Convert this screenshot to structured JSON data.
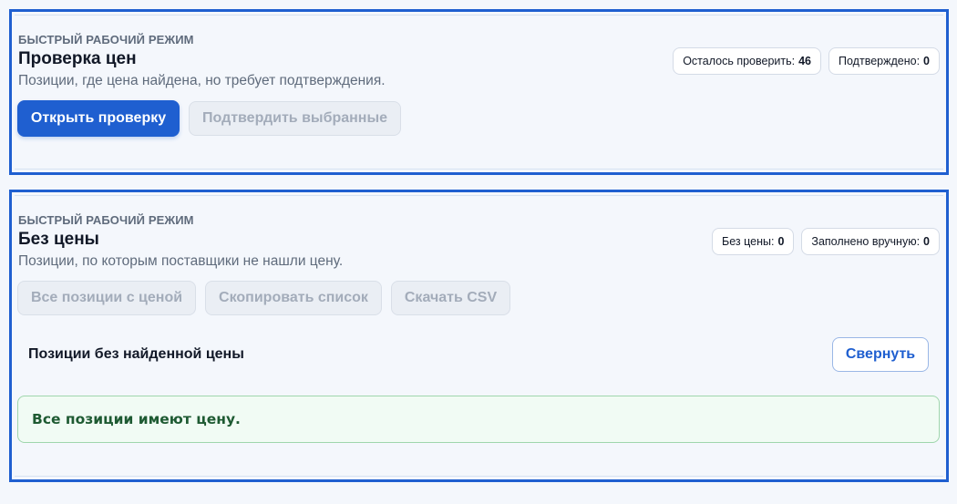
{
  "price_check": {
    "eyebrow": "БЫСТРЫЙ РАБОЧИЙ РЕЖИМ",
    "title": "Проверка цен",
    "description": "Позиции, где цена найдена, но требует подтверждения.",
    "stats": [
      {
        "label": "Осталось проверить:",
        "value": "46"
      },
      {
        "label": "Подтверждено:",
        "value": "0"
      }
    ],
    "open_button": "Открыть проверку",
    "confirm_button": "Подтвердить выбранные"
  },
  "no_price": {
    "eyebrow": "БЫСТРЫЙ РАБОЧИЙ РЕЖИМ",
    "title": "Без цены",
    "description": "Позиции, по которым поставщики не нашли цену.",
    "stats": [
      {
        "label": "Без цены:",
        "value": "0"
      },
      {
        "label": "Заполнено вручную:",
        "value": "0"
      }
    ],
    "all_priced_button": "Все позиции с ценой",
    "copy_list_button": "Скопировать список",
    "download_csv_button": "Скачать CSV",
    "list_title": "Позиции без найденной цены",
    "collapse_button": "Свернуть",
    "empty_message": "Все позиции имеют цену."
  }
}
